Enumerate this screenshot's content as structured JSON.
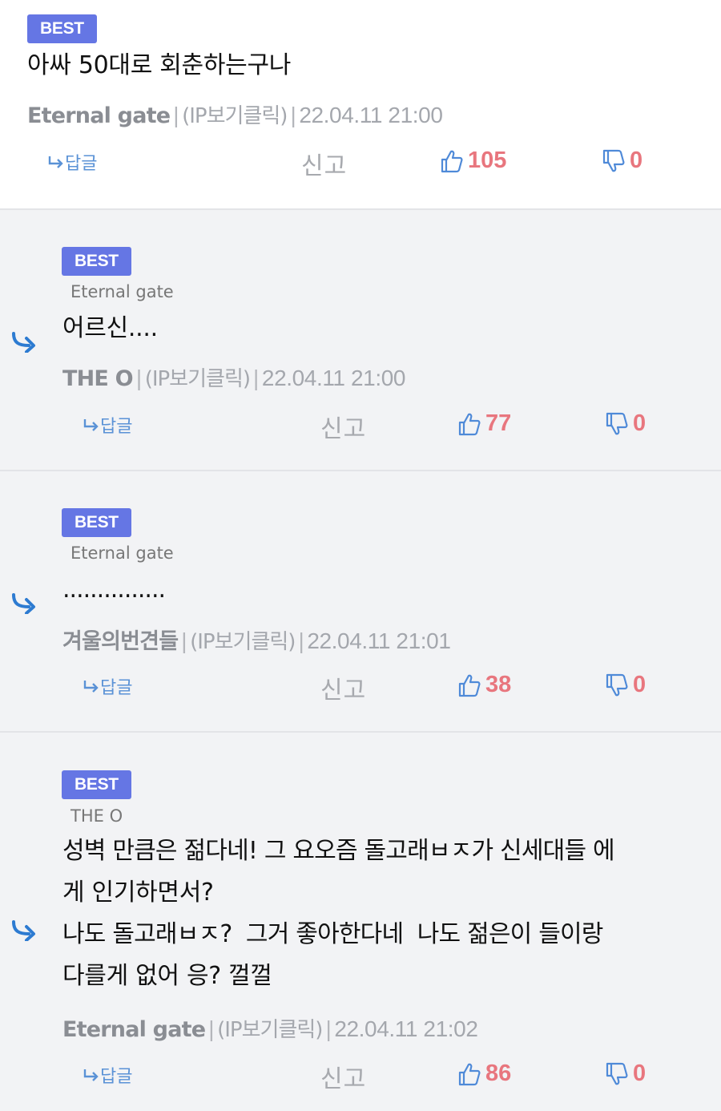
{
  "labels": {
    "badge": "BEST",
    "reply": "답글",
    "report": "신고",
    "sep": "|"
  },
  "comments": [
    {
      "text": "아싸 50대로 회춘하는구나",
      "author": "Eternal gate",
      "ip": "(IP보기클릭)",
      "date": "22.04.11 21:00",
      "likes": "105",
      "dislikes": "0"
    },
    {
      "reply_to": "Eternal gate",
      "text": "어르신....",
      "author": "THE O",
      "ip": "(IP보기클릭)",
      "date": "22.04.11 21:00",
      "likes": "77",
      "dislikes": "0"
    },
    {
      "reply_to": "Eternal gate",
      "text": "...............",
      "author": "겨울의번견들",
      "ip": "(IP보기클릭)",
      "date": "22.04.11 21:01",
      "likes": "38",
      "dislikes": "0"
    },
    {
      "reply_to": "THE O",
      "lines": [
        "성벽 만큼은 젊다네! 그 요오즘 돌고래ㅂㅈ가 신세대들 에",
        "게 인기하면서?",
        "나도 돌고래ㅂㅈ?  그거 좋아한다네  나도 젊은이 들이랑",
        "다를게 없어 응? 껄껄"
      ],
      "author": "Eternal gate",
      "ip": "(IP보기클릭)",
      "date": "22.04.11 21:02",
      "likes": "86",
      "dislikes": "0"
    }
  ],
  "colors": {
    "badge": "#6576e4",
    "reply_link": "#5a92d6",
    "vote_count": "#e8767e",
    "icon_blue": "#4f8ad8",
    "reply_bg": "#f2f3f5"
  },
  "icons": {
    "reply_link": "return-arrow-icon",
    "like": "thumbs-up-icon",
    "dislike": "thumbs-down-icon",
    "nested_reply": "curved-reply-arrow-icon"
  }
}
